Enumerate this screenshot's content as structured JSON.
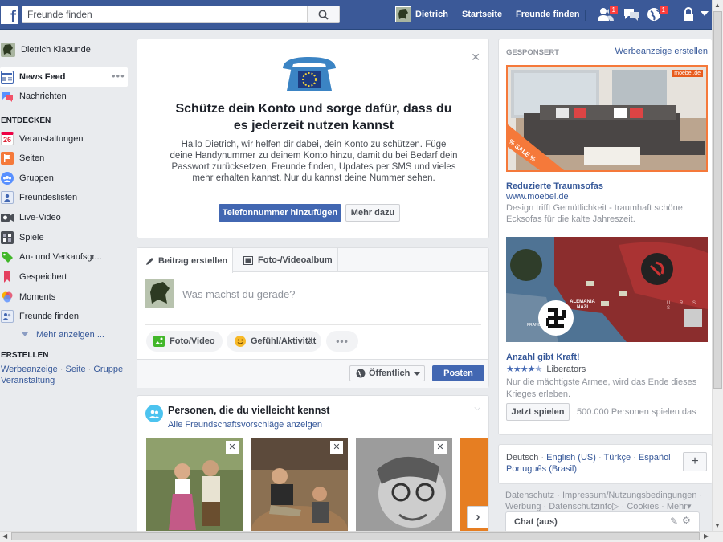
{
  "topbar": {
    "search_placeholder": "Freunde finden",
    "user_name": "Dietrich",
    "home_label": "Startseite",
    "find_friends_label": "Freunde finden",
    "friend_requests_badge": "1",
    "notifications_badge": "1"
  },
  "sidebar": {
    "profile_name": "Dietrich Klabunde",
    "items": [
      {
        "label": "News Feed"
      },
      {
        "label": "Nachrichten"
      }
    ],
    "discover_heading": "ENTDECKEN",
    "discover": [
      {
        "label": "Veranstaltungen",
        "icon_text": "26"
      },
      {
        "label": "Seiten"
      },
      {
        "label": "Gruppen"
      },
      {
        "label": "Freundeslisten"
      },
      {
        "label": "Live-Video"
      },
      {
        "label": "Spiele"
      },
      {
        "label": "An- und Verkaufsgr..."
      },
      {
        "label": "Gespeichert"
      },
      {
        "label": "Moments"
      },
      {
        "label": "Freunde finden"
      }
    ],
    "more_label": "Mehr anzeigen ...",
    "create_heading": "ERSTELLEN",
    "create_links": [
      "Werbeanzeige",
      "Seite",
      "Gruppe",
      "Veranstaltung"
    ]
  },
  "security_card": {
    "title": "Schütze dein Konto und sorge dafür, dass du es jederzeit nutzen kannst",
    "body": "Hallo Dietrich, wir helfen dir dabei, dein Konto zu schützen. Füge deine Handynummer zu deinem Konto hinzu, damit du bei Bedarf dein Passwort zurücksetzen, Freunde finden, Updates per SMS und vieles mehr erhalten kannst. Nur du kannst deine Nummer sehen.",
    "primary_button": "Telefonnummer hinzufügen",
    "secondary_button": "Mehr dazu"
  },
  "composer": {
    "tabs": [
      "Beitrag erstellen",
      "Foto-/Videoalbum"
    ],
    "placeholder": "Was machst du gerade?",
    "actions": [
      "Foto/Video",
      "Gefühl/Aktivität"
    ],
    "audience": "Öffentlich",
    "post_button": "Posten"
  },
  "pymk": {
    "title": "Personen, die du vielleicht kennst",
    "link": "Alle Freundschaftsvorschläge anzeigen"
  },
  "sponsored": {
    "heading": "GESPONSERT",
    "create_ad": "Werbeanzeige erstellen",
    "ads": [
      {
        "title": "Reduzierte Traumsofas",
        "domain": "www.moebel.de",
        "text": "Design trifft Gemütlichkeit - traumhaft schöne Ecksofas für die kalte Jahreszeit.",
        "sale_ribbon": "% SALE %",
        "brand_tag": "moebel.de"
      },
      {
        "title": "Anzahl gibt Kraft!",
        "rating_label": "Liberators",
        "rating": 4.5,
        "text": "Nur die mächtigste Armee, wird das Ende dieses Krieges erleben.",
        "button": "Jetzt spielen",
        "players": "500.000 Personen spielen das",
        "map_labels": [
          "ALEMANIA NAZI",
          "FRANCIA",
          "U R S S"
        ]
      }
    ]
  },
  "languages": {
    "current": "Deutsch",
    "others": [
      "English (US)",
      "Türkçe",
      "Español",
      "Português (Brasil)"
    ]
  },
  "footer": {
    "links": [
      "Datenschutz",
      "Impressum/Nutzungsbedingungen",
      "Werbung",
      "Datenschutzinfo",
      "Cookies",
      "Mehr"
    ]
  },
  "chat": {
    "label": "Chat (aus)"
  },
  "colors": {
    "brand": "#3b5998",
    "button": "#4267b2",
    "link": "#365899"
  }
}
